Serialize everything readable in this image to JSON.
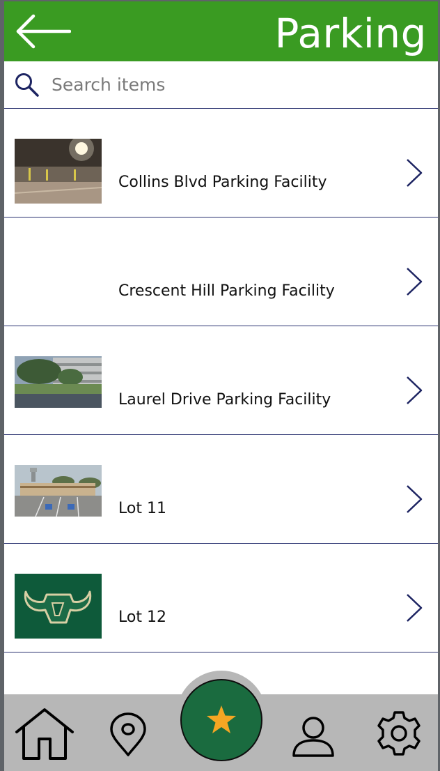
{
  "header": {
    "title": "Parking",
    "background_color": "#3a9b22",
    "back_icon": "arrow-left-icon"
  },
  "search": {
    "placeholder": "Search items",
    "value": "",
    "icon": "search-icon"
  },
  "list": {
    "items": [
      {
        "label": "Collins Blvd Parking Facility",
        "has_image": true,
        "image": "parking-garage-interior-photo"
      },
      {
        "label": "Crescent Hill Parking Facility",
        "has_image": false,
        "image": ""
      },
      {
        "label": "Laurel Drive Parking Facility",
        "has_image": true,
        "image": "parking-garage-exterior-photo"
      },
      {
        "label": "Lot 11",
        "has_image": true,
        "image": "surface-lot-photo"
      },
      {
        "label": "Lot 12",
        "has_image": true,
        "image": "bull-logo"
      }
    ],
    "row_chevron_icon": "chevron-right-icon",
    "divider_color": "#2a3270"
  },
  "bottom_nav": {
    "background_color": "#b7b7b7",
    "items": [
      {
        "name": "home",
        "icon": "home-icon"
      },
      {
        "name": "location",
        "icon": "map-pin-icon"
      },
      {
        "name": "favorites",
        "icon": "star-icon",
        "active": true
      },
      {
        "name": "profile",
        "icon": "user-icon"
      },
      {
        "name": "settings",
        "icon": "gear-icon"
      }
    ],
    "fab_color": "#1a6b3f",
    "star_color": "#f5a623"
  }
}
